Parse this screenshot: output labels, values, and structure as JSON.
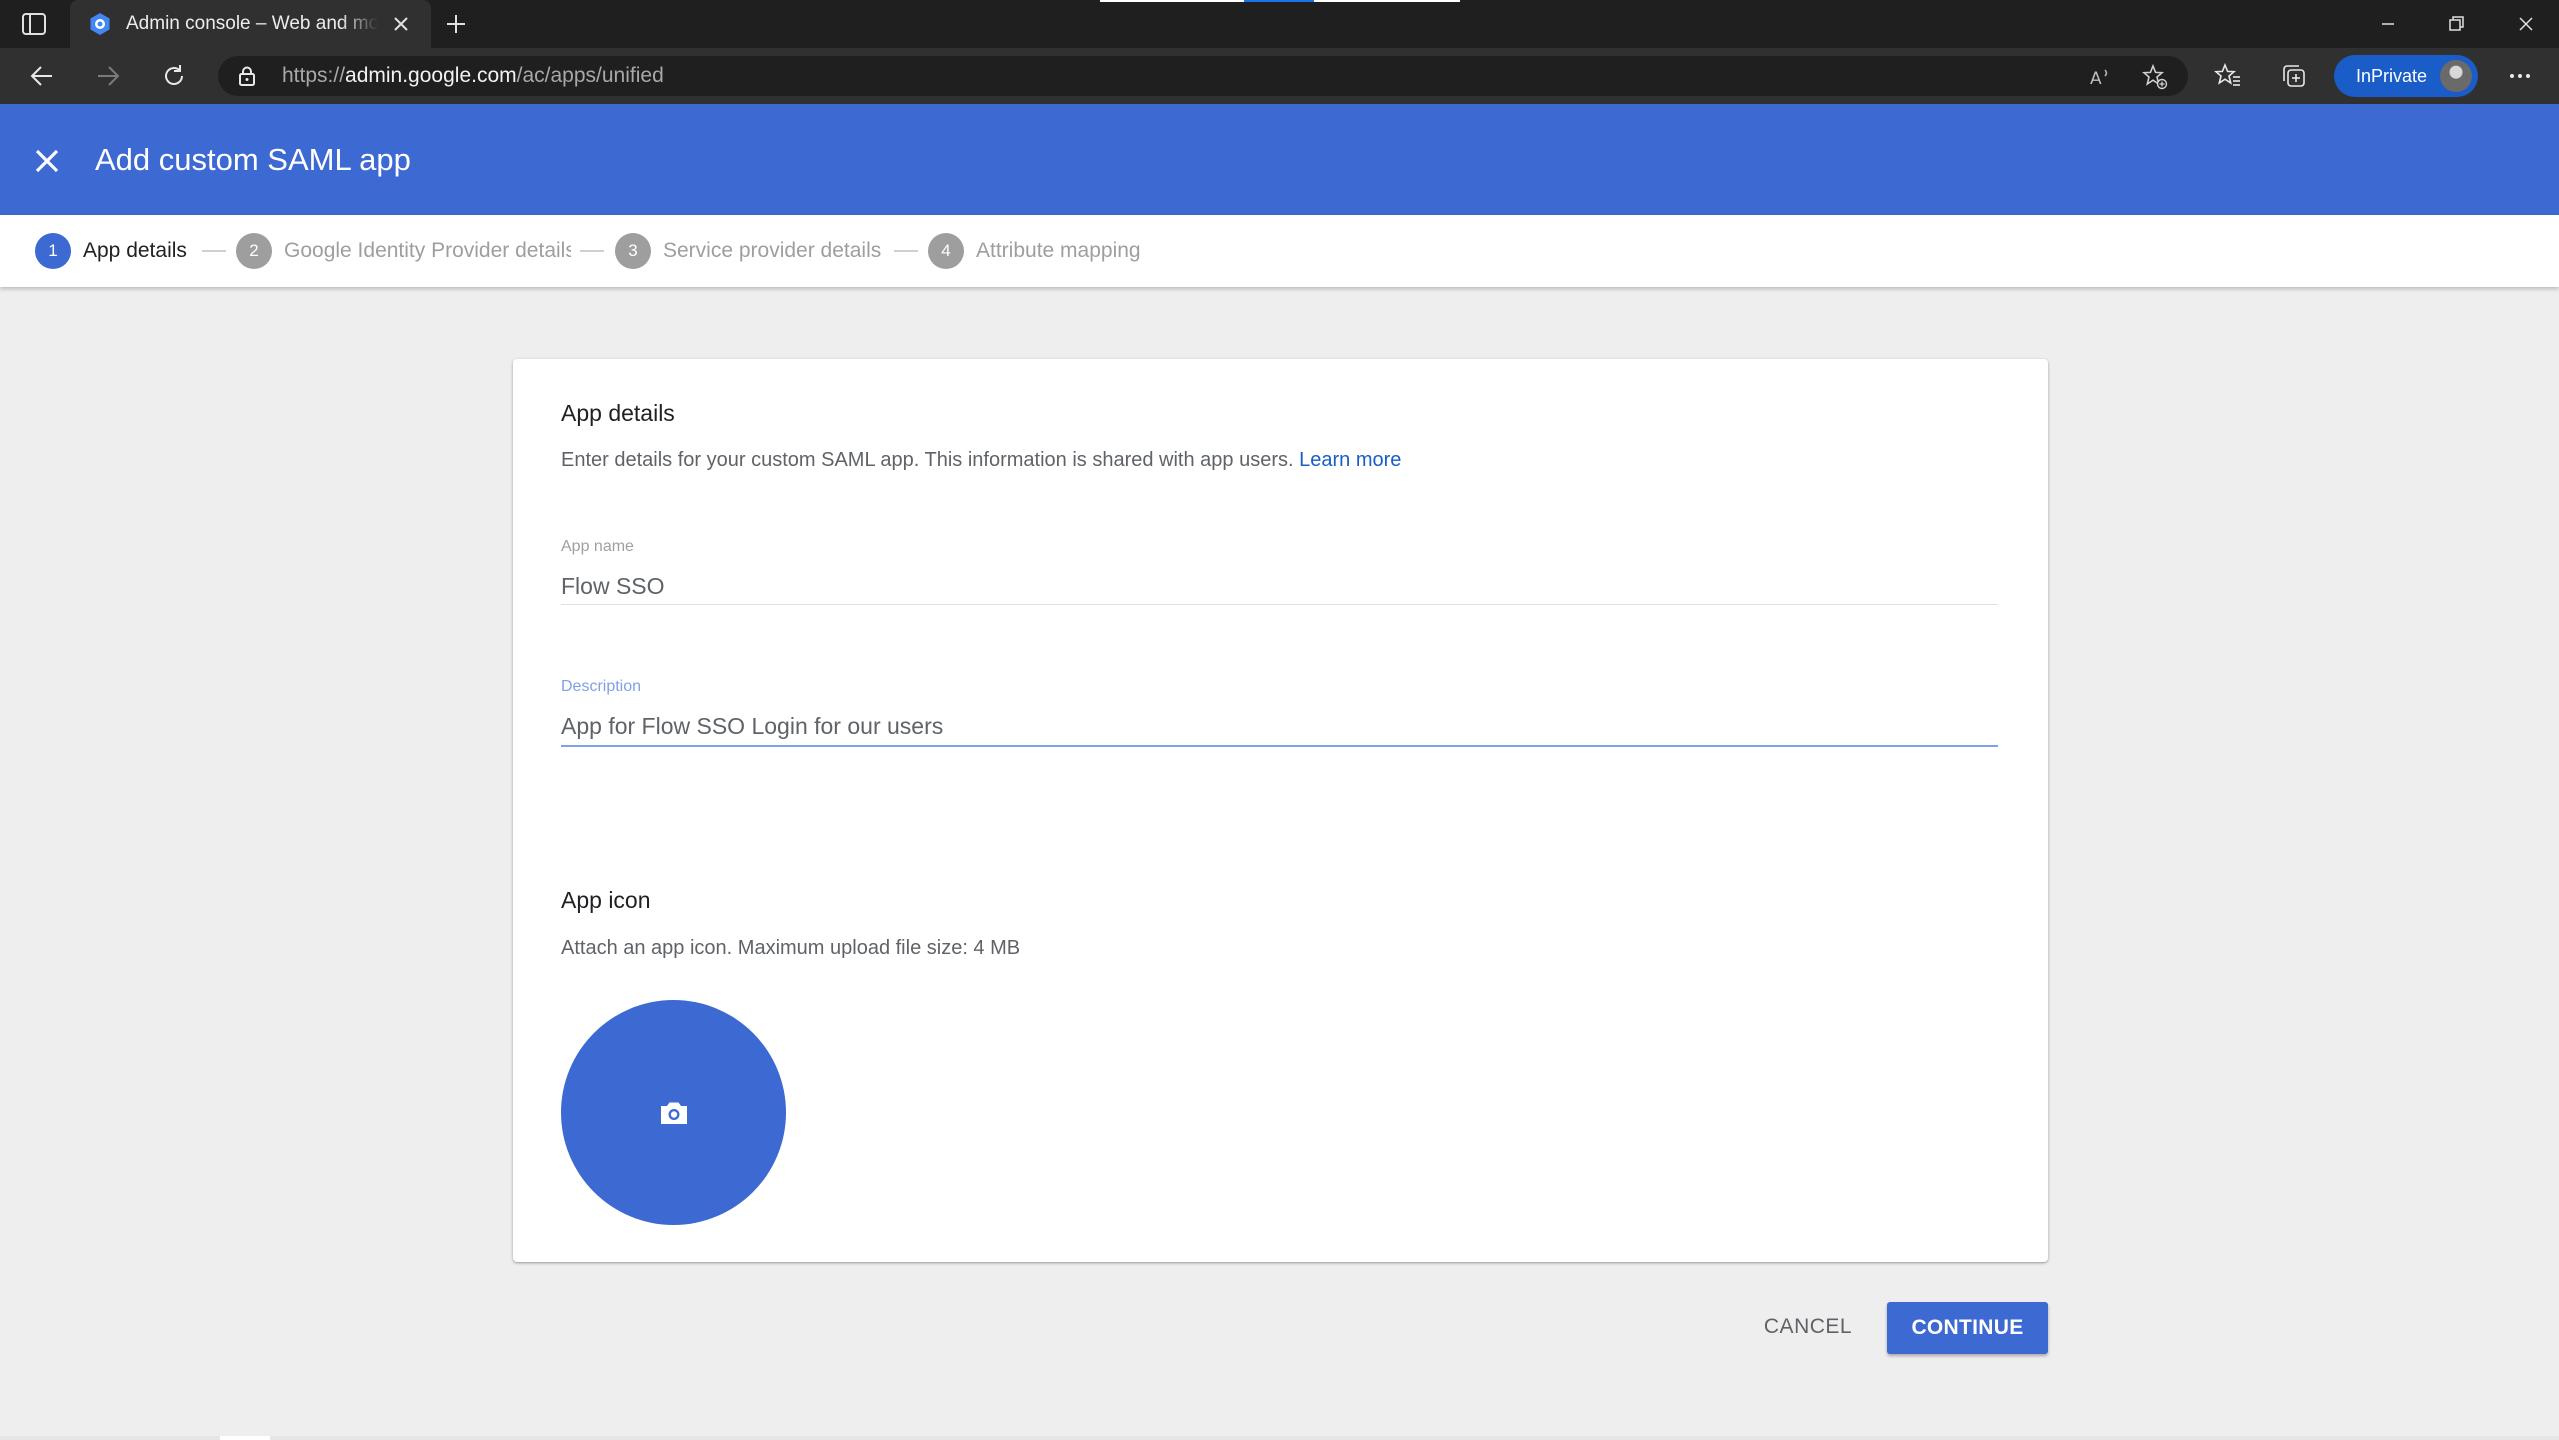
{
  "browser": {
    "tab_title": "Admin console – Web and mobile apps",
    "url_scheme": "https://",
    "url_host": "admin.google.com",
    "url_path": "/ac/apps/unified",
    "inprivate_label": "InPrivate"
  },
  "header": {
    "title": "Add custom SAML app",
    "close_icon": "close-icon"
  },
  "stepper": {
    "steps": [
      {
        "number": "1",
        "label": "App details",
        "state": "active"
      },
      {
        "number": "2",
        "label": "Google Identity Provider details",
        "state": "inactive"
      },
      {
        "number": "3",
        "label": "Service provider details",
        "state": "inactive"
      },
      {
        "number": "4",
        "label": "Attribute mapping",
        "state": "inactive"
      }
    ]
  },
  "app_details": {
    "title": "App details",
    "description": "Enter details for your custom SAML app. This information is shared with app users.",
    "learn_more": "Learn more",
    "app_name_label": "App name",
    "app_name_value": "Flow SSO",
    "description_label": "Description",
    "description_value": "App for Flow SSO Login for our users"
  },
  "app_icon": {
    "title": "App icon",
    "description": "Attach an app icon. Maximum upload file size: 4 MB",
    "upload_icon": "camera-icon"
  },
  "actions": {
    "cancel": "CANCEL",
    "continue": "CONTINUE"
  },
  "colors": {
    "brand_blue": "#3d69d2",
    "link_blue": "#1a5dc8",
    "chrome_dark": "#1f1f1f",
    "chrome_bar": "#303030",
    "page_bg": "#eeeeee"
  }
}
